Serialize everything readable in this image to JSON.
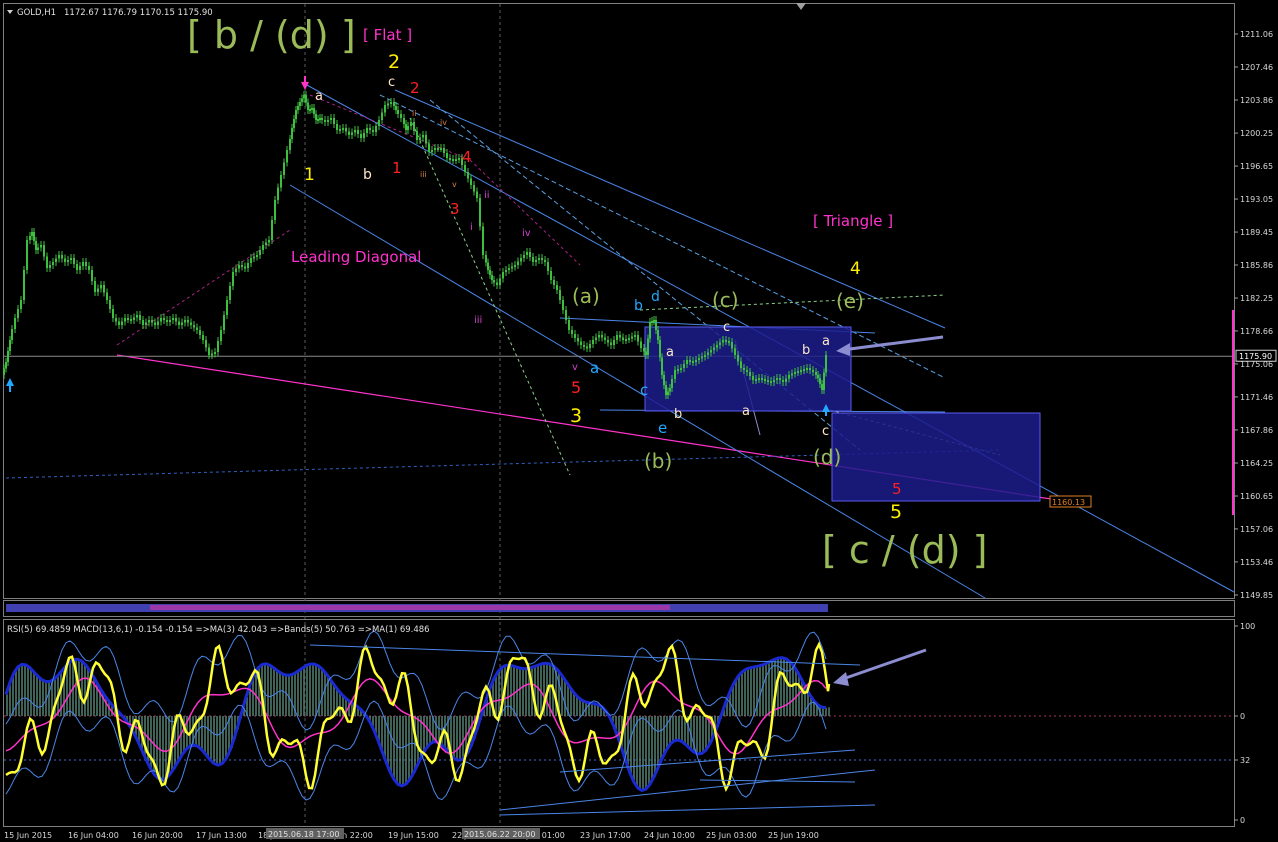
{
  "header": {
    "symbol": "GOLD,H1",
    "ohlc": "1172.67 1176.79 1170.15 1175.90"
  },
  "colors": {
    "background": "#000000",
    "candle": "#3fbf3f",
    "price_line": "#808080",
    "magenta": "#ff33cc",
    "channel": "#4a86e8",
    "box_fill": "#1c1c8c",
    "wave_green": "#9bbb59",
    "wave_yellow": "#ffee00",
    "wave_red": "#ff2020",
    "wave_cyan": "#22a8ff",
    "wave_white": "#ffe8c8",
    "rsi": "#ffff33",
    "arrow": "#8c8cd0"
  },
  "chart_data": [
    {
      "type": "line",
      "title": "GOLD,H1",
      "ylim": [
        1148.2,
        1213.8
      ],
      "y_ticks": [
        "1211.06",
        "1207.46",
        "1203.86",
        "1200.25",
        "1196.65",
        "1193.05",
        "1189.45",
        "1185.86",
        "1182.25",
        "1178.66",
        "1175.06",
        "1171.46",
        "1167.86",
        "1164.25",
        "1160.65",
        "1157.06",
        "1153.46",
        "1149.85"
      ],
      "x_ticks": [
        "15 Jun 2015",
        "16 Jun 04:00",
        "16 Jun 20:00",
        "17 Jun 13:00",
        "18 Jun 05:00",
        "18 Jun 22:00",
        "19 Jun 15:00",
        "22 Jun 08:00",
        "23 Jun 01:00",
        "23 Jun 17:00",
        "24 Jun 10:00",
        "25 Jun 03:00",
        "25 Jun 19:00"
      ],
      "x_tick_highlights": [
        "2015.06.18 17:00",
        "2015.06.22 20:00"
      ],
      "current_price": "1175.90",
      "target_price": "1160.13",
      "wave_labels": [
        {
          "text": "[ b / (d) ]",
          "color": "#9bbb59"
        },
        {
          "text": "[ Flat ]",
          "color": "#ff33cc"
        },
        {
          "text": "[ Triangle ]",
          "color": "#ff33cc"
        },
        {
          "text": "Leading Diagonal",
          "color": "#ff33cc"
        },
        {
          "text": "[ c / (d) ]",
          "color": "#9bbb59"
        },
        {
          "text": "2",
          "color": "#ffee00"
        },
        {
          "text": "c",
          "color": "#ffe8c8"
        },
        {
          "text": "2",
          "color": "#ff2020"
        },
        {
          "text": "a",
          "color": "#ffe8c8"
        },
        {
          "text": "1",
          "color": "#ffee00"
        },
        {
          "text": "b",
          "color": "#ffe8c8"
        },
        {
          "text": "1",
          "color": "#ff2020"
        },
        {
          "text": "ii",
          "color": "#d08040"
        },
        {
          "text": "iii",
          "color": "#d08040"
        },
        {
          "text": "iv",
          "color": "#d08040"
        },
        {
          "text": "v",
          "color": "#d08040"
        },
        {
          "text": "4",
          "color": "#ff2020"
        },
        {
          "text": "3",
          "color": "#ff2020"
        },
        {
          "text": "i",
          "color": "#cc44cc"
        },
        {
          "text": "ii",
          "color": "#cc44cc"
        },
        {
          "text": "iii",
          "color": "#cc44cc"
        },
        {
          "text": "iv",
          "color": "#cc44cc"
        },
        {
          "text": "v",
          "color": "#cc44cc"
        },
        {
          "text": "5",
          "color": "#ff2020"
        },
        {
          "text": "3",
          "color": "#ffee00"
        },
        {
          "text": "(a)",
          "color": "#9bbb59"
        },
        {
          "text": "a",
          "color": "#22a8ff"
        },
        {
          "text": "b",
          "color": "#22a8ff"
        },
        {
          "text": "d",
          "color": "#22a8ff"
        },
        {
          "text": "c",
          "color": "#22a8ff"
        },
        {
          "text": "e",
          "color": "#22a8ff"
        },
        {
          "text": "a",
          "color": "#ffe8c8"
        },
        {
          "text": "b",
          "color": "#ffe8c8"
        },
        {
          "text": "(b)",
          "color": "#9bbb59"
        },
        {
          "text": "(c)",
          "color": "#9bbb59"
        },
        {
          "text": "c",
          "color": "#ffe8c8"
        },
        {
          "text": "a",
          "color": "#ffe8c8"
        },
        {
          "text": "b",
          "color": "#ffe8c8"
        },
        {
          "text": "a",
          "color": "#ffe8c8"
        },
        {
          "text": "c",
          "color": "#ffe8c8"
        },
        {
          "text": "(d)",
          "color": "#9bbb59"
        },
        {
          "text": "4",
          "color": "#ffee00"
        },
        {
          "text": "(e)",
          "color": "#9bbb59"
        },
        {
          "text": "5",
          "color": "#ff2020"
        },
        {
          "text": "5",
          "color": "#ffee00"
        }
      ]
    },
    {
      "type": "line",
      "title": "RSI(5) 69.4859 MACD(13,6,1) -0.154 -0.154 =>MA(3) 42.043 =>Bands(5) 50.763 =>MA(1) 69.486",
      "ylim": [
        0,
        100
      ],
      "y_ticks": [
        "100",
        "0",
        "32",
        "0"
      ]
    }
  ]
}
